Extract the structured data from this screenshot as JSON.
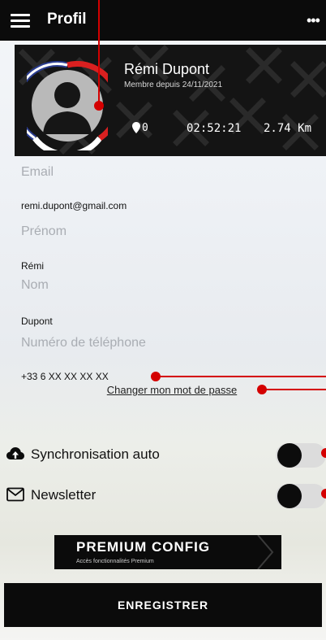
{
  "header": {
    "title": "Profil",
    "more_glyph": "•••"
  },
  "profile": {
    "name": "Rémi Dupont",
    "member_since": "Membre depuis 24/11/2021",
    "stats": {
      "spots": "0",
      "duration": "02:52:21",
      "distance": "2.74 Km"
    }
  },
  "form": {
    "email_label": "Email",
    "email_value": "remi.dupont@gmail.com",
    "firstname_label": "Prénom",
    "firstname_value": "Rémi",
    "lastname_label": "Nom",
    "lastname_value": "Dupont",
    "phone_label": "Numéro de téléphone",
    "phone_value": "+33 6 XX XX XX XX",
    "change_password": "Changer mon mot de passe"
  },
  "toggles": {
    "sync_label": "Synchronisation auto",
    "newsletter_label": "Newsletter"
  },
  "premium": {
    "title": "PREMIUM CONFIG",
    "subtitle": "Accès fonctionnalités Premium"
  },
  "save_label": "ENREGISTRER",
  "colors": {
    "callout": "#d40000",
    "flag_blue": "#2a3c8f",
    "flag_red": "#d92020",
    "dark": "#0b0b0b"
  },
  "icons": {
    "menu": "hamburger-icon",
    "more": "more-icon",
    "location": "map-pin-icon",
    "cloud": "cloud-upload-icon",
    "mail": "envelope-icon"
  }
}
